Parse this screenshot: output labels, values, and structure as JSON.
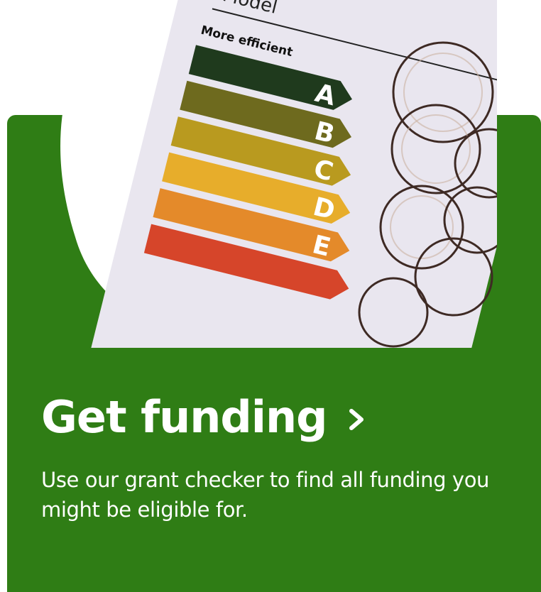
{
  "card": {
    "background_color": "#2f7d15",
    "heading": "Get funding",
    "heading_icon": "chevron-right-icon",
    "description": "Use our grant checker to find all funding you might be eligible for."
  },
  "image": {
    "icon": "energy-rating-photo",
    "label_model": "Model",
    "label_more_efficient": "More efficient",
    "rating_letters": [
      "A",
      "B",
      "C",
      "D",
      "E"
    ],
    "rating_colors": [
      "#1f3a1d",
      "#6e6a1e",
      "#b99a1f",
      "#e7ad2b",
      "#e48a2a",
      "#d6452a"
    ]
  }
}
